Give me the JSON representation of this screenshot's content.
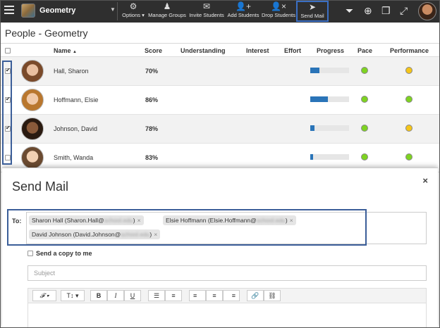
{
  "topbar": {
    "course_name": "Geometry",
    "tools": [
      {
        "label": "Options ▾",
        "icon": "gears-icon"
      },
      {
        "label": "Manage Groups",
        "icon": "groups-icon"
      },
      {
        "label": "Invite Students",
        "icon": "envelope-icon"
      },
      {
        "label": "Add Students",
        "icon": "add-user-icon"
      },
      {
        "label": "Drop Students",
        "icon": "drop-user-icon"
      },
      {
        "label": "Send Mail",
        "icon": "paper-plane-icon"
      }
    ]
  },
  "page": {
    "title": "People - Geometry"
  },
  "table": {
    "headers": {
      "name": "Name",
      "name_sort": "▲",
      "score": "Score",
      "understanding": "Understanding",
      "interest": "Interest",
      "effort": "Effort",
      "progress": "Progress",
      "pace": "Pace",
      "performance": "Performance"
    },
    "rows": [
      {
        "name": "Hall, Sharon",
        "score": "70%",
        "checked": true,
        "progress": 0.24,
        "pace": "#7ed321",
        "performance": "#f5c518"
      },
      {
        "name": "Hoffmann, Elsie",
        "score": "86%",
        "checked": true,
        "progress": 0.45,
        "pace": "#7ed321",
        "performance": "#7ed321"
      },
      {
        "name": "Johnson, David",
        "score": "78%",
        "checked": true,
        "progress": 0.1,
        "pace": "#7ed321",
        "performance": "#f5c518"
      },
      {
        "name": "Smith, Wanda",
        "score": "83%",
        "checked": false,
        "progress": 0.08,
        "pace": "#7ed321",
        "performance": "#7ed321"
      }
    ]
  },
  "modal": {
    "title": "Send Mail",
    "close": "×",
    "to_label": "To:",
    "recipients": [
      {
        "name": "Sharon Hall (Sharon.Hall@",
        "domain": "school.edu",
        "end": ")"
      },
      {
        "name": "Elsie Hoffmann (Elsie.Hoffmann@",
        "domain": "school.edu",
        "end": ")"
      },
      {
        "name": "David Johnson (David.Johnson@",
        "domain": "school.edu",
        "end": ")"
      }
    ],
    "remove": "×",
    "copy_label": "Send a copy to me",
    "subject_placeholder": "Subject",
    "toolbar": {
      "font": "𝓕 ▾",
      "size": "T↕ ▾",
      "bold": "B",
      "italic": "I",
      "underline": "U",
      "bullets": "☰",
      "numbers": "≡",
      "align_left": "≡",
      "align_center": "≡",
      "align_right": "≡",
      "link": "🔗",
      "unlink": "⛓"
    }
  },
  "colors": {
    "topbar": "#2f2f2f",
    "accent_highlight": "#3b5e99",
    "progress_fill": "#2a74b8",
    "green": "#7ed321",
    "yellow": "#f5c518"
  }
}
